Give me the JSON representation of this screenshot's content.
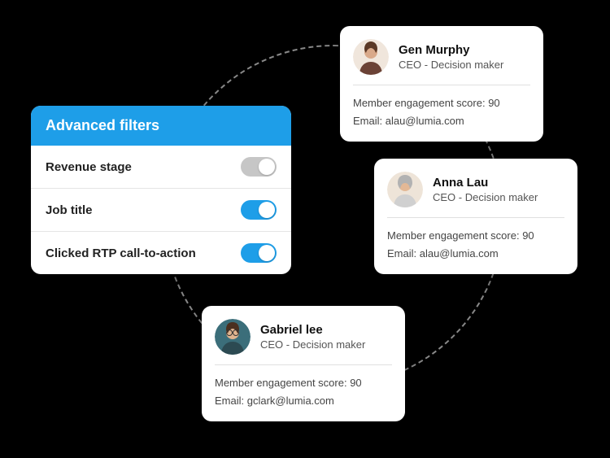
{
  "filters": {
    "title": "Advanced filters",
    "rows": [
      {
        "label": "Revenue stage",
        "on": false
      },
      {
        "label": "Job title",
        "on": true
      },
      {
        "label": "Clicked RTP call-to-action",
        "on": true
      }
    ]
  },
  "contacts": [
    {
      "name": "Gen Murphy",
      "role": "CEO - Decision maker",
      "score_label": "Member engagement score: 90",
      "email_label": "Email: alau@lumia.com"
    },
    {
      "name": "Anna Lau",
      "role": "CEO - Decision maker",
      "score_label": "Member engagement score: 90",
      "email_label": "Email: alau@lumia.com"
    },
    {
      "name": "Gabriel lee",
      "role": "CEO - Decision maker",
      "score_label": "Member engagement score: 90",
      "email_label": "Email: gclark@lumia.com"
    }
  ]
}
